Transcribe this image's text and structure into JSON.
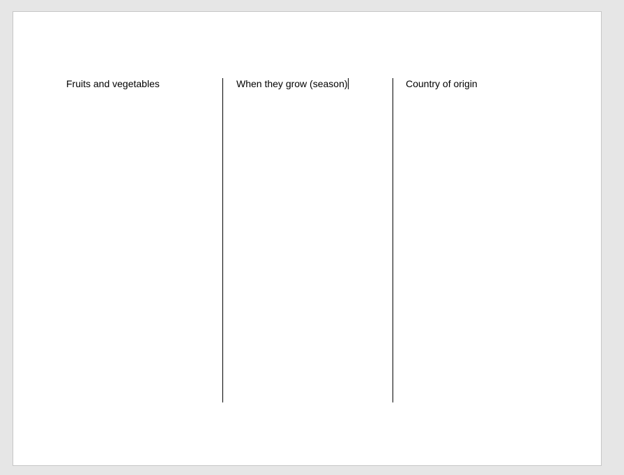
{
  "document": {
    "columns": [
      {
        "heading": "Fruits and vegetables"
      },
      {
        "heading": "When they grow (season)"
      },
      {
        "heading": "Country of origin"
      }
    ]
  },
  "colors": {
    "background": "#e6e6e6",
    "page": "#ffffff",
    "text": "#000000"
  }
}
